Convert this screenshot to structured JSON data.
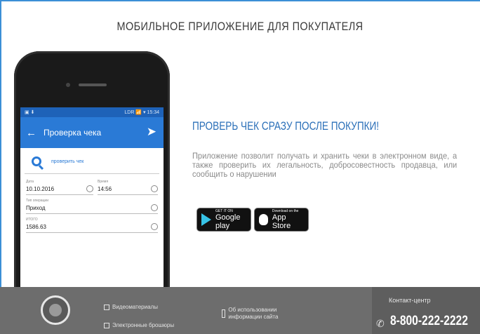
{
  "page": {
    "title": "МОБИЛЬНОЕ ПРИЛОЖЕНИЕ ДЛЯ ПОКУПАТЕЛЯ"
  },
  "phone": {
    "status": {
      "left": "▣ ⬇",
      "right": "LDR 📶 ▾ 15:34"
    },
    "appbar_title": "Проверка чека",
    "search_placeholder": "проверить чек",
    "fields": {
      "date_label": "Дата",
      "date_value": "10.10.2016",
      "time_label": "Время",
      "time_value": "14:56",
      "type_label": "Тип операции",
      "type_value": "Приход",
      "sum_label": "ИТОГО",
      "sum_value": "1586.63"
    }
  },
  "promo": {
    "headline": "ПРОВЕРЬ ЧЕК СРАЗУ ПОСЛЕ ПОКУПКИ!",
    "description": "Приложение позволит получать и хранить чеки в электронном виде, а также проверить их легальность, добросовестность продавца, или сообщить о нарушении",
    "google_play": {
      "small": "GET IT ON",
      "big": "Google play"
    },
    "app_store": {
      "small": "Download on the",
      "big": "App Store"
    }
  },
  "footer": {
    "link1": "Видеоматериалы",
    "link2": "Электронные брошюры",
    "link3": "Об использовании информации сайта",
    "contact_label": "Контакт-центр",
    "contact_phone": "8-800-222-2222"
  },
  "colors": {
    "accent": "#2a7ad6",
    "headline": "#2a6fb8",
    "footer": "#6d6d6d",
    "frame": "#3b8fd6"
  }
}
